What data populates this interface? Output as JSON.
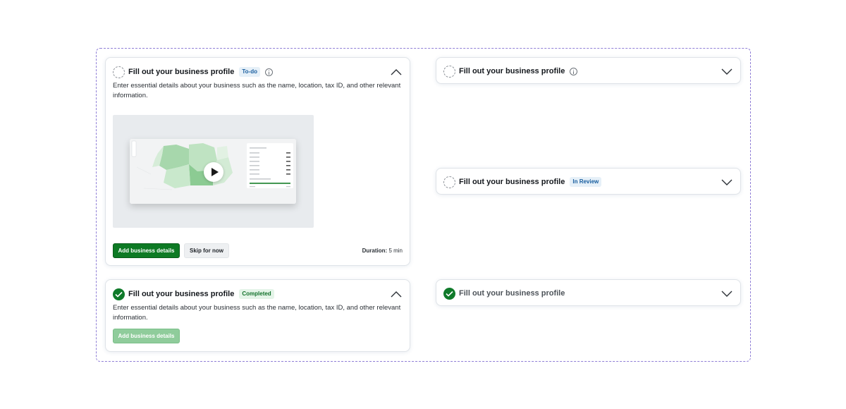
{
  "cards": {
    "todo": {
      "title": "Fill out your business profile",
      "badge": "To-do",
      "description": "Enter essential details about your business such as the name, location, tax ID, and other relevant information.",
      "primary_button": "Add business details",
      "secondary_button": "Skip for now",
      "duration_label": "Duration:",
      "duration_value": "5 min"
    },
    "completed": {
      "title": "Fill out your business profile",
      "badge": "Completed",
      "description": "Enter essential details about your business such as the name, location, tax ID, and other relevant information.",
      "button": "Add business details"
    },
    "collapsed_info": {
      "title": "Fill out your business profile"
    },
    "collapsed_review": {
      "title": "Fill out your business profile",
      "badge": "In Review"
    },
    "collapsed_done": {
      "title": "Fill out your business profile"
    }
  },
  "icons": {
    "pending": "dashed-circle-icon",
    "done": "check-circle-icon",
    "info": "info-icon",
    "expand": "chevron-down-icon",
    "collapse": "chevron-up-icon",
    "play": "play-icon"
  },
  "colors": {
    "primary": "#0d7a24",
    "primary_disabled": "#8fcc9b",
    "badge_info_bg": "#e6f0f8",
    "badge_info_text": "#1a5fa0",
    "badge_success_bg": "#e4f4e8",
    "badge_success_text": "#13722c",
    "frame_border": "#8f7ed6"
  }
}
